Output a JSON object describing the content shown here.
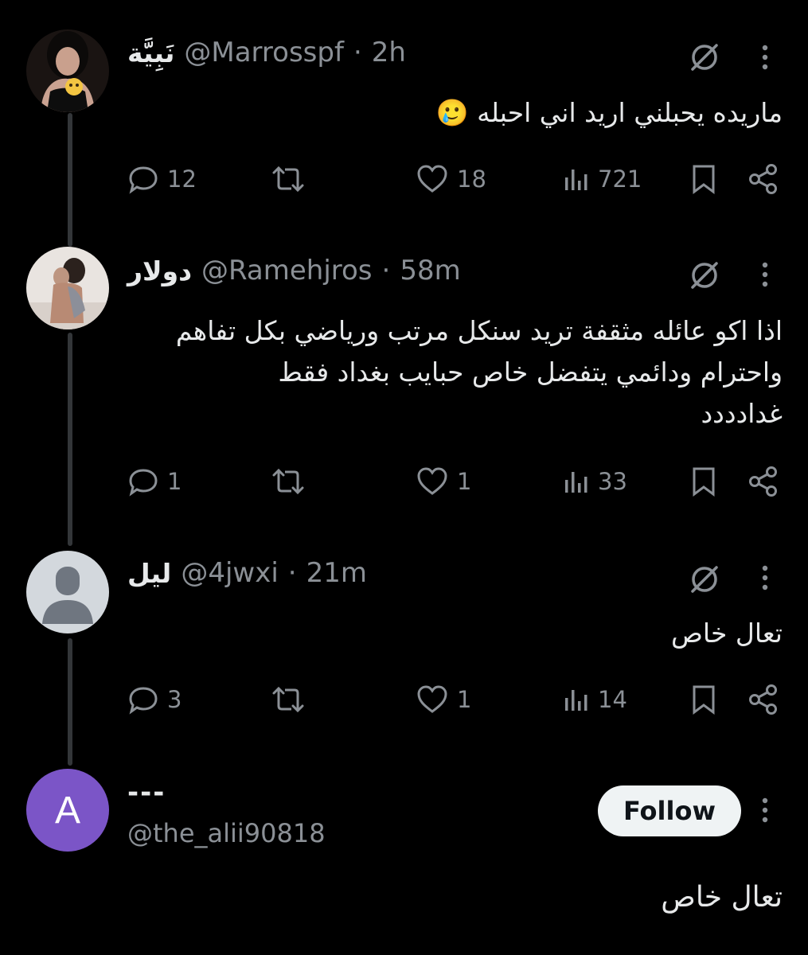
{
  "colors": {
    "background": "#000000",
    "text": "#e7e9ea",
    "muted": "#8b9096",
    "thread_line": "#333639",
    "follow_bg": "#eff3f4",
    "letter_avatar": "#7b55c7"
  },
  "posts": [
    {
      "name": "نَبِيَّة",
      "handle": "@Marrosspf",
      "separator": "·",
      "time": "2h",
      "text_lines": [
        "ماريده يحبلني اريد اني احبله 🥲"
      ],
      "replies": "12",
      "likes": "18",
      "views": "721",
      "icons": [
        "grok-icon",
        "more-icon",
        "reply-icon",
        "retweet-icon",
        "like-icon",
        "views-icon",
        "bookmark-icon",
        "share-icon"
      ]
    },
    {
      "name": "دولار",
      "handle": "@Ramehjros",
      "separator": "·",
      "time": "58m",
      "text_lines": [
        "اذا اكو عائله مثقفة تريد سنكل مرتب ورياضي بكل تفاهم",
        "واحترام ودائمي يتفضل خاص حبايب بغداد فقط",
        "غدادددد"
      ],
      "replies": "1",
      "likes": "1",
      "views": "33"
    },
    {
      "name": "ليل",
      "handle": "@4jwxi",
      "separator": "·",
      "time": "21m",
      "text_lines": [
        "تعال خاص"
      ],
      "replies": "3",
      "likes": "1",
      "views": "14"
    }
  ],
  "focused": {
    "avatar_letter": "A",
    "name": "---",
    "handle": "@the_alii90818",
    "follow_label": "Follow",
    "text": "تعال خاص"
  }
}
